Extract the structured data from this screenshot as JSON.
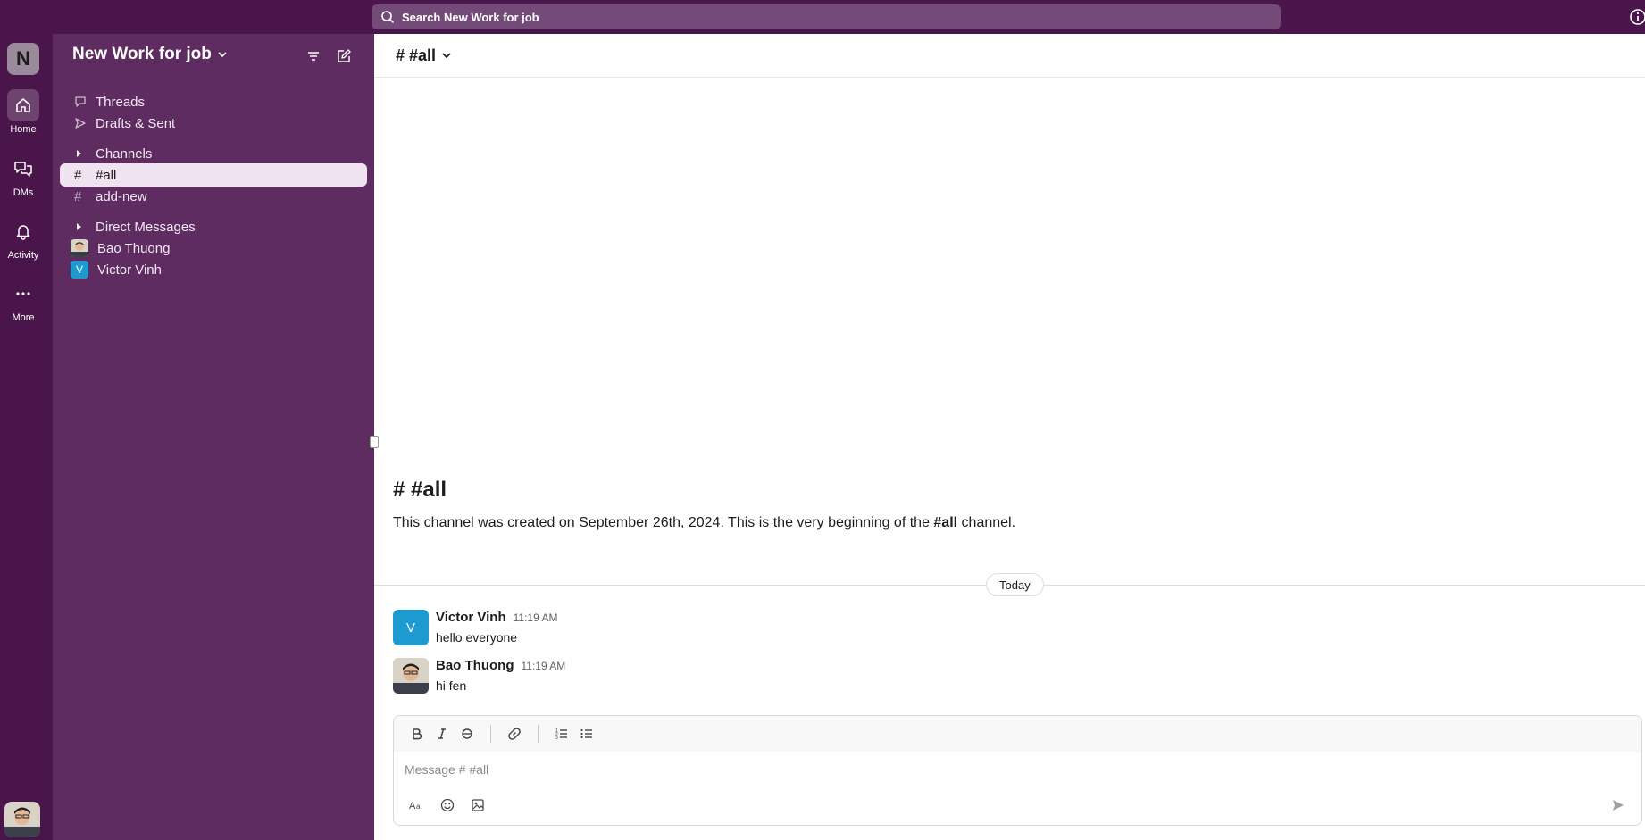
{
  "search": {
    "placeholder": "Search New Work for job"
  },
  "rail": {
    "workspace_initial": "N",
    "items": [
      {
        "label": "Home",
        "icon": "home-icon"
      },
      {
        "label": "DMs",
        "icon": "dms-icon"
      },
      {
        "label": "Activity",
        "icon": "bell-icon"
      },
      {
        "label": "More",
        "icon": "more-icon"
      }
    ]
  },
  "sidebar": {
    "workspace_name": "New Work for job",
    "nav": [
      {
        "label": "Threads",
        "icon": "threads-icon"
      },
      {
        "label": "Drafts & Sent",
        "icon": "send-icon"
      }
    ],
    "channels_label": "Channels",
    "channels": [
      {
        "label": "#all",
        "active": true
      },
      {
        "label": "add-new",
        "active": false
      }
    ],
    "dms_label": "Direct Messages",
    "dms": [
      {
        "label": "Bao Thuong",
        "avatar": "photo"
      },
      {
        "label": "Victor Vinh",
        "avatar_initial": "V"
      }
    ]
  },
  "channel": {
    "header": "# #all",
    "intro_title": "# #all",
    "intro_pre": "This channel was created on September 26th, 2024. This is the very beginning of the ",
    "intro_bold": "#all",
    "intro_post": " channel.",
    "date_divider": "Today"
  },
  "messages": [
    {
      "author": "Victor Vinh",
      "time": "11:19 AM",
      "text": "hello everyone",
      "avatar_initial": "V"
    },
    {
      "author": "Bao Thuong",
      "time": "11:19 AM",
      "text": "hi fen"
    }
  ],
  "composer": {
    "placeholder": "Message # #all"
  },
  "colors": {
    "aubergine": "#4a154b",
    "sidebar": "#5e2c60",
    "accent_blue": "#1d9bd1"
  }
}
